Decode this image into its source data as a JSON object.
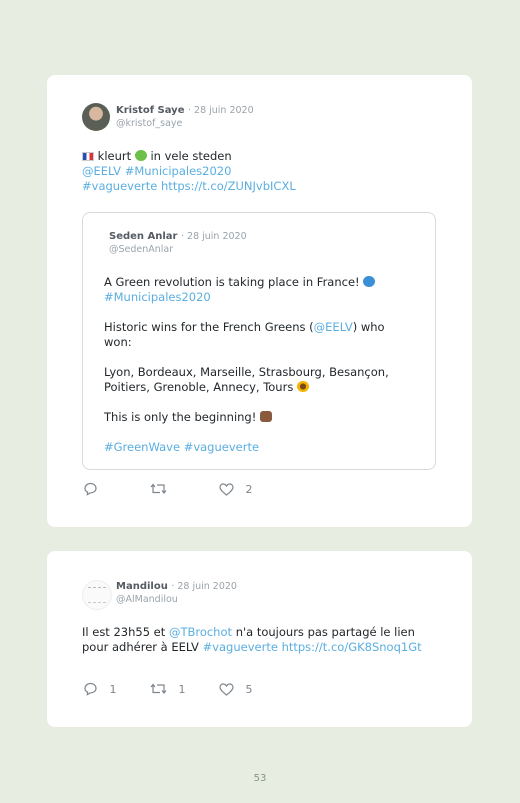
{
  "tweet1": {
    "author_name": "Kristof Saye",
    "date": "· 28 juin 2020",
    "handle": "@kristof_saye",
    "text_part1": "kleurt",
    "text_part2": "in vele steden",
    "mention": "@EELV",
    "hashtag1": "#Municipales2020",
    "hashtag2": "#vagueverte",
    "url": "https://t.co/ZUNJvbICXL",
    "quote": {
      "author_name": "Seden Anlar",
      "date": "· 28 juin 2020",
      "handle": "@SedenAnlar",
      "line1": "A Green revolution is taking place in France!",
      "line2": "#Municipales2020",
      "line3_a": "Historic wins for the French Greens (",
      "line3_mention": "@EELV",
      "line3_b": ") who",
      "line4": "won:",
      "line5": "Lyon, Bordeaux, Marseille, Strasbourg, Besançon,",
      "line6": "Poitiers, Grenoble, Annecy, Tours",
      "line7": "This is only the beginning!",
      "hashtag_a": "#GreenWave",
      "hashtag_b": "#vagueverte"
    },
    "likes": "2"
  },
  "tweet2": {
    "author_name": "Mandilou",
    "date": "· 28 juin 2020",
    "handle": "@AlMandilou",
    "line1_a": "Il est 23h55 et",
    "line1_mention": "@TBrochot",
    "line1_b": "n'a toujours pas partagé le lien",
    "line2_a": "pour adhérer à EELV",
    "line2_hashtag": "#vagueverte",
    "line2_url": "https://t.co/GK8Snoq1Gt",
    "replies": "1",
    "retweets": "1",
    "likes": "5"
  },
  "page_number": "53",
  "colors": {
    "link": "#5aaee0",
    "background": "#e7ede0",
    "card": "#ffffff"
  },
  "emojis": [
    "flag-france",
    "green-heart",
    "water-wave",
    "sunflower",
    "raised-fist"
  ]
}
